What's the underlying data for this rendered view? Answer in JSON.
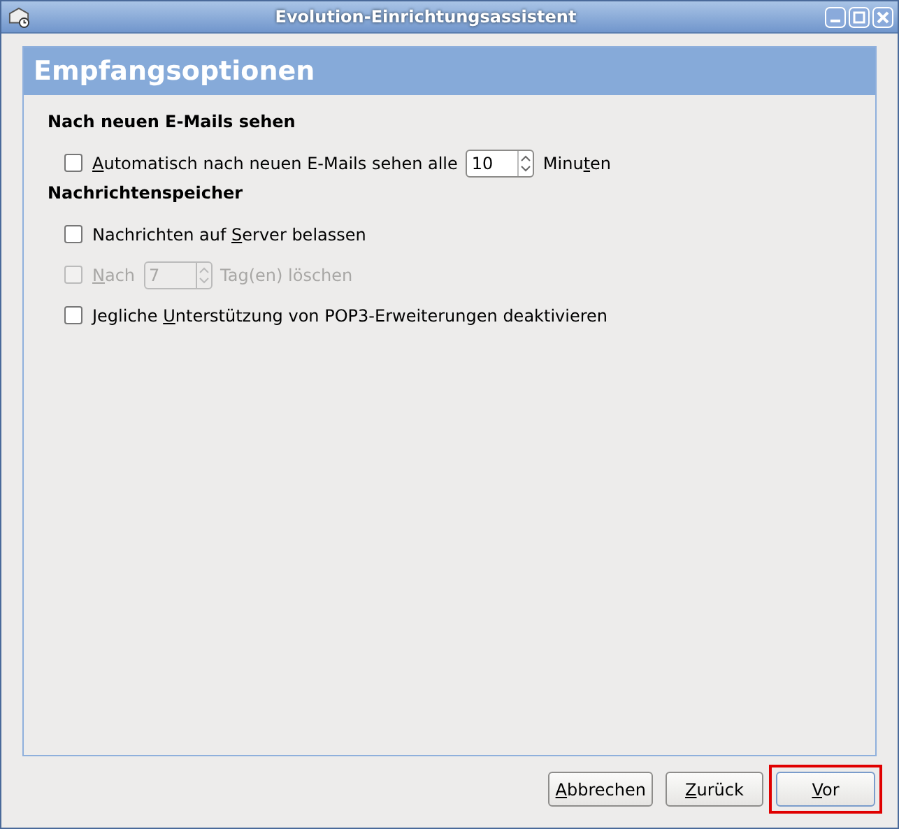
{
  "window": {
    "title": "Evolution-Einrichtungsassistent"
  },
  "page": {
    "title": "Empfangsoptionen"
  },
  "sections": [
    {
      "heading": "Nach neuen E-Mails sehen",
      "options": [
        {
          "kind": "spin",
          "checked": false,
          "disabled": false,
          "label": {
            "key": "A",
            "post": "utomatisch nach neuen E-Mails sehen alle"
          },
          "value": "10",
          "unit": {
            "pre": "Minu",
            "key": "t",
            "post": "en"
          }
        }
      ]
    },
    {
      "heading": "Nachrichtenspeicher",
      "options": [
        {
          "kind": "check",
          "checked": false,
          "disabled": false,
          "label": {
            "pre": "Nachrichten auf ",
            "key": "S",
            "post": "erver belassen"
          }
        },
        {
          "kind": "spin",
          "checked": false,
          "disabled": true,
          "label": {
            "key": "N",
            "post": "ach"
          },
          "value": "7",
          "unit": {
            "post": "Tag(en) löschen"
          }
        },
        {
          "kind": "check",
          "checked": false,
          "disabled": false,
          "label": {
            "pre": "Jegliche ",
            "key": "U",
            "post": "nterstützung von POP3-Erweiterungen deaktivieren"
          }
        }
      ]
    }
  ],
  "buttons": [
    {
      "label": {
        "key": "A",
        "post": "bbrechen"
      },
      "highlighted": false
    },
    {
      "label": {
        "key": "Z",
        "post": "urück"
      },
      "highlighted": false
    },
    {
      "label": {
        "key": "V",
        "post": "or"
      },
      "highlighted": true
    }
  ]
}
